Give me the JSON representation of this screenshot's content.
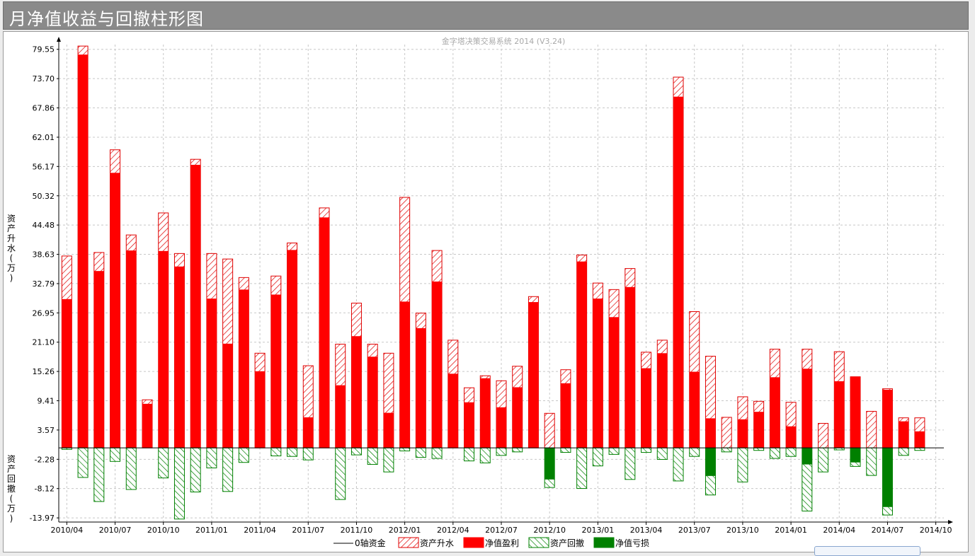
{
  "window": {
    "title": "月净值收益与回撤柱形图"
  },
  "chart_data": {
    "type": "bar",
    "subtitle": "金字塔决策交易系统 2014 (V3.24)",
    "ylabel_positive": "资产升水(万)",
    "ylabel_negative": "资产回撤(万)",
    "y_ticks": [
      "79.55",
      "73.70",
      "67.86",
      "62.01",
      "56.17",
      "50.32",
      "44.48",
      "38.63",
      "32.79",
      "26.95",
      "21.10",
      "15.26",
      "9.41",
      "3.57",
      "-2.28",
      "-8.12",
      "-13.97"
    ],
    "ylim": [
      -14.8,
      80.5
    ],
    "x_tick_labels": [
      "2010/04",
      "2010/07",
      "2010/10",
      "2011/01",
      "2011/04",
      "2011/07",
      "2011/10",
      "2012/01",
      "2012/04",
      "2012/07",
      "2012/10",
      "2013/01",
      "2013/04",
      "2013/07",
      "2013/10",
      "2014/01",
      "2014/04",
      "2014/07",
      "2014/10"
    ],
    "grid": true,
    "legend_position": "bottom",
    "colors": {
      "asset_rise": "#ff0000",
      "net_profit": "#ff0000",
      "asset_drawdown": "#008000",
      "net_loss": "#008000",
      "zero_line": "#000000"
    },
    "legend": [
      {
        "label": "0轴资金",
        "style": "line"
      },
      {
        "label": "资产升水",
        "style": "hatch-red"
      },
      {
        "label": "净值盈利",
        "style": "solid-red"
      },
      {
        "label": "资产回撤",
        "style": "hatch-green"
      },
      {
        "label": "净值亏损",
        "style": "solid-green"
      }
    ],
    "categories": [
      "2010/04",
      "2010/05",
      "2010/06",
      "2010/07",
      "2010/08",
      "2010/09",
      "2010/10",
      "2010/11",
      "2010/12",
      "2011/01",
      "2011/02",
      "2011/03",
      "2011/04",
      "2011/05",
      "2011/06",
      "2011/07",
      "2011/08",
      "2011/09",
      "2011/10",
      "2011/11",
      "2011/12",
      "2012/01",
      "2012/02",
      "2012/03",
      "2012/04",
      "2012/05",
      "2012/06",
      "2012/07",
      "2012/08",
      "2012/09",
      "2012/10",
      "2012/11",
      "2012/12",
      "2013/01",
      "2013/02",
      "2013/03",
      "2013/04",
      "2013/05",
      "2013/06",
      "2013/07",
      "2013/08",
      "2013/09",
      "2013/10",
      "2013/11",
      "2013/12",
      "2014/01",
      "2014/02",
      "2014/03",
      "2014/04",
      "2014/05",
      "2014/06",
      "2014/07",
      "2014/08",
      "2014/09",
      "2014/10"
    ],
    "series": [
      {
        "name": "资产升水",
        "values": [
          38.3,
          80.2,
          39.0,
          59.5,
          42.5,
          9.6,
          46.9,
          38.8,
          57.6,
          38.8,
          37.7,
          34.0,
          18.9,
          34.3,
          40.9,
          16.4,
          47.9,
          20.7,
          28.9,
          20.7,
          18.9,
          50.0,
          26.9,
          39.4,
          21.5,
          12.0,
          14.4,
          13.4,
          16.3,
          30.2,
          6.9,
          15.6,
          38.5,
          32.9,
          31.6,
          35.8,
          19.1,
          21.5,
          74.0,
          27.2,
          18.3,
          6.1,
          10.2,
          9.3,
          19.7,
          9.1,
          19.7,
          4.9,
          19.2,
          14.2,
          7.3,
          11.8,
          6.0,
          6.0,
          0.0
        ]
      },
      {
        "name": "净值盈利",
        "values": [
          29.7,
          78.5,
          35.3,
          54.9,
          39.4,
          8.8,
          39.3,
          36.2,
          56.5,
          29.8,
          20.8,
          31.6,
          15.3,
          30.6,
          39.5,
          6.1,
          46.0,
          12.5,
          22.3,
          18.2,
          7.0,
          29.2,
          23.9,
          33.2,
          14.8,
          9.1,
          13.9,
          8.1,
          12.1,
          29.1,
          0.0,
          12.9,
          37.2,
          29.8,
          26.1,
          32.1,
          15.9,
          18.9,
          70.1,
          15.2,
          5.9,
          0.0,
          5.7,
          7.2,
          14.1,
          4.3,
          15.8,
          0.0,
          13.3,
          14.2,
          0.0,
          11.6,
          5.3,
          3.3,
          0.0
        ]
      },
      {
        "name": "资产回撤",
        "values": [
          -0.3,
          -5.9,
          -10.7,
          -2.7,
          -8.3,
          0.0,
          -6.0,
          -14.2,
          -8.8,
          -4.0,
          -8.7,
          -2.9,
          0.0,
          -1.6,
          -1.7,
          -2.4,
          0.0,
          -10.3,
          -1.4,
          -3.3,
          -4.8,
          -0.6,
          -1.9,
          -2.1,
          0.0,
          -2.6,
          -3.0,
          -1.5,
          -0.8,
          0.0,
          -7.9,
          -0.9,
          -8.1,
          -3.6,
          -1.3,
          -6.3,
          -0.9,
          -2.3,
          -6.6,
          -1.7,
          -9.4,
          -0.8,
          -6.8,
          -0.5,
          -2.1,
          -1.7,
          -12.6,
          -4.8,
          -0.4,
          -3.7,
          -5.5,
          -13.4,
          -1.5,
          -0.5,
          0.0
        ]
      },
      {
        "name": "净值亏损",
        "values": [
          0.0,
          0.0,
          0.0,
          0.0,
          0.0,
          0.0,
          0.0,
          0.0,
          0.0,
          0.0,
          0.0,
          0.0,
          0.0,
          0.0,
          0.0,
          0.0,
          0.0,
          0.0,
          0.0,
          0.0,
          0.0,
          0.0,
          0.0,
          0.0,
          0.0,
          0.0,
          0.0,
          0.0,
          0.0,
          0.0,
          -6.3,
          0.0,
          0.0,
          0.0,
          0.0,
          0.0,
          0.0,
          0.0,
          0.0,
          0.0,
          -5.6,
          0.0,
          0.0,
          0.0,
          0.0,
          0.0,
          -3.3,
          0.0,
          0.0,
          -2.9,
          0.0,
          -11.8,
          0.0,
          0.0,
          0.0
        ]
      }
    ]
  }
}
